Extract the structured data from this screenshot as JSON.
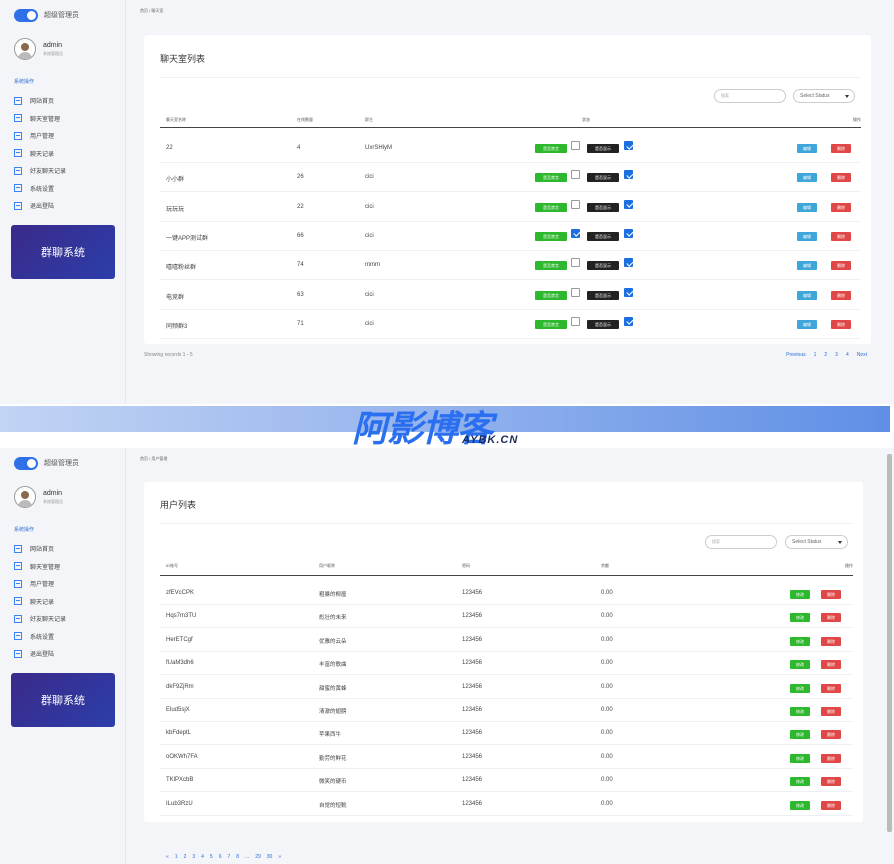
{
  "brand": "超级管理员",
  "user": {
    "name": "admin",
    "role": "系统管理员"
  },
  "section_title": "系统操作",
  "menu": [
    "网站首页",
    "聊天室管理",
    "用户管理",
    "聊天记录",
    "好友聊天记录",
    "系统设置",
    "退出登陆"
  ],
  "banner": "群聊系统",
  "chat_panel": {
    "breadcrumb": "首页  /  聊天室",
    "title": "聊天室列表",
    "search_placeholder": "搜索",
    "status_select": "Select Status",
    "headers": [
      "聊天室名称",
      "在线数量",
      "群主",
      "状态",
      "操作"
    ],
    "mute_label": "是否禁言",
    "show_label": "是否显示",
    "edit_label": "编辑",
    "delete_label": "删除",
    "rows": [
      {
        "name": "22",
        "count": "4",
        "owner": "UxrSHlyM",
        "mute": false,
        "show": true,
        "mute_alt": "是否禁言"
      },
      {
        "name": "小小群",
        "count": "26",
        "owner": "cici",
        "mute": false,
        "show": true,
        "mute_alt": "是否禁言"
      },
      {
        "name": "玩玩玩",
        "count": "22",
        "owner": "cici",
        "mute": false,
        "show": true,
        "mute_alt": "是否禁言"
      },
      {
        "name": "一键APP测试群",
        "count": "66",
        "owner": "cici",
        "mute": true,
        "show": true,
        "mute_alt": "是否禁言"
      },
      {
        "name": "嘻嘻粉丝群",
        "count": "74",
        "owner": "mmm",
        "mute": false,
        "show": true,
        "mute_alt": "是否禁言"
      },
      {
        "name": "电竞群",
        "count": "63",
        "owner": "cici",
        "mute": false,
        "show": true,
        "mute_alt": "是否禁言"
      },
      {
        "name": "同频群3",
        "count": "71",
        "owner": "cici",
        "mute": false,
        "show": true,
        "mute_alt": "是否禁言"
      }
    ],
    "showing": "Showing records 1 - 5",
    "pager": [
      "Previous",
      "1",
      "2",
      "3",
      "4",
      "Next"
    ]
  },
  "watermark": {
    "cn": "阿影博客",
    "en": "AYBK.CN"
  },
  "user_panel": {
    "breadcrumb": "首页  /  用户管理",
    "title": "用户列表",
    "search_placeholder": "搜索",
    "status_select": "Select Status",
    "headers": [
      "ID账号",
      "用户昵称",
      "密码",
      "余额",
      "操作"
    ],
    "edit_label": "修改",
    "delete_label": "删除",
    "rows": [
      {
        "id": "zfEVcCPK",
        "nick": "粗暴的柳屋",
        "pwd": "123456",
        "bal": "0.00"
      },
      {
        "id": "Hqs7m3TU",
        "nick": "彪壮的未来",
        "pwd": "123456",
        "bal": "0.00"
      },
      {
        "id": "HerETCgf",
        "nick": "优雅的云朵",
        "pwd": "123456",
        "bal": "0.00"
      },
      {
        "id": "fUaM3dh6",
        "nick": "丰富的歌曲",
        "pwd": "123456",
        "bal": "0.00"
      },
      {
        "id": "dkF9ZjRm",
        "nick": "甜蜜的黄蜂",
        "pwd": "123456",
        "bal": "0.00"
      },
      {
        "id": "Elud5sjX",
        "nick": "清澈的翅膀",
        "pwd": "123456",
        "bal": "0.00"
      },
      {
        "id": "kbFdeptL",
        "nick": "苹果西牛",
        "pwd": "123456",
        "bal": "0.00"
      },
      {
        "id": "oOKWh7FA",
        "nick": "勤劳的鲜花",
        "pwd": "123456",
        "bal": "0.00"
      },
      {
        "id": "TKlPXcbB",
        "nick": "微笑的硬币",
        "pwd": "123456",
        "bal": "0.00"
      },
      {
        "id": "ILub3RzU",
        "nick": "自觉的短靴",
        "pwd": "123456",
        "bal": "0.00"
      }
    ],
    "pager": [
      "«",
      "1",
      "2",
      "3",
      "4",
      "5",
      "6",
      "7",
      "8",
      "...",
      "29",
      "30",
      "»"
    ]
  }
}
